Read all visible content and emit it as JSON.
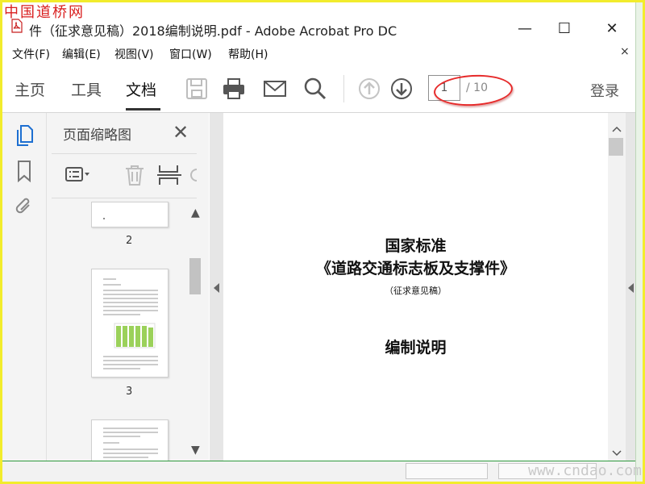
{
  "window": {
    "title": "件（征求意见稿）2018编制说明.pdf - Adobe Acrobat Pro DC",
    "controls": {
      "minimize": "—",
      "maximize": "☐",
      "close": "✕"
    }
  },
  "menu": {
    "items": [
      "文件(F)",
      "编辑(E)",
      "视图(V)",
      "窗口(W)",
      "帮助(H)"
    ],
    "close": "×"
  },
  "toolbar": {
    "tabs": [
      "主页",
      "工具",
      "文档"
    ],
    "active_tab": "文档",
    "page_current": "1",
    "page_total": "/ 10",
    "login": "登录"
  },
  "thumb_panel": {
    "title": "页面缩略图",
    "close": "✕",
    "page_labels": [
      "2",
      "3"
    ],
    "scroll_up": "▲",
    "scroll_down": "▼"
  },
  "document": {
    "line1": "国家标准",
    "line2": "《道路交通标志板及支撑件》",
    "line3": "（征求意见稿）",
    "line4": "编制说明"
  },
  "watermarks": {
    "top": "中国道桥网",
    "bottom": "www.cndao.com"
  },
  "colors": {
    "accent_blue": "#1d6fd1",
    "highlight_red": "#e62a2a",
    "frame_yellow": "#f2ec2c",
    "chart_green": "#9bd15a"
  }
}
